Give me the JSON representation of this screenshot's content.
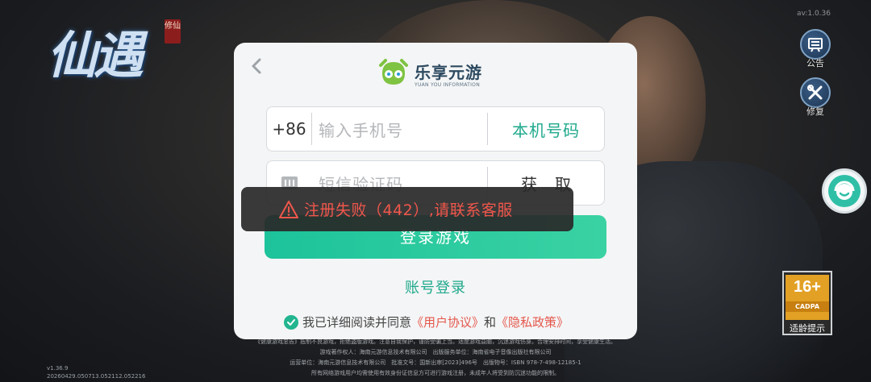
{
  "game": {
    "logo_text": "仙遇",
    "logo_seal": "修仙",
    "version_top": "av:1.0.36",
    "build_info": [
      "v1.36.9",
      "20260429.050713.052112.052216"
    ]
  },
  "side": {
    "notice_label": "公告",
    "repair_label": "修复"
  },
  "age_rating": {
    "age": "16+",
    "org": "CADPA",
    "tip": "适龄提示"
  },
  "legal_lines": [
    "《健康游戏忠告》抵制不良游戏，拒绝盗版游戏。注意自我保护，谨防受骗上当。适度游戏益脑，沉迷游戏伤身。合理安排时间，享受健康生活。",
    "游戏著作权人：海南元游信息技术有限公司　出版服务单位：海南省电子音像出版社有限公司",
    "运营单位：海南元游信息技术有限公司　批准文号：国新出审[2023]496号　出版物号：ISBN 978-7-498-12185-1",
    "所有网络游戏用户均需使用有效身份证信息方可进行游戏注册，未成年人将受到防沉迷功能的限制。"
  ],
  "dialog": {
    "brand_name": "乐享元游",
    "brand_sub": "YUAN YOU INFORMATION",
    "country_code": "+86",
    "phone_placeholder": "输入手机号",
    "local_number_label": "本机号码",
    "code_placeholder": "短信验证码",
    "get_code_label": "获取",
    "login_label": "登录游戏",
    "account_login_label": "账号登录",
    "agree_prefix": "我已详细阅读并同意",
    "user_agreement": "《用户协议》",
    "and": "和",
    "privacy_policy": "《隐私政策》"
  },
  "toast": {
    "message": "注册失败（442）,请联系客服"
  },
  "colors": {
    "accent": "#1fa98c",
    "button": "#2ccb9f",
    "error": "#f0574b",
    "link": "#e5574c"
  }
}
